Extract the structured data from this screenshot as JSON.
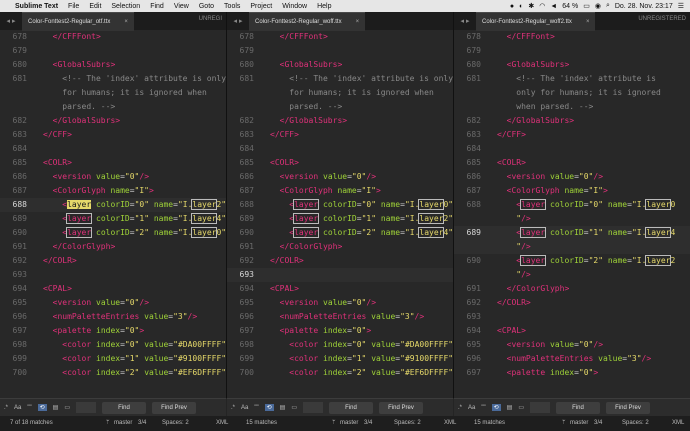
{
  "menubar": {
    "apple": "",
    "app_name": "Sublime Text",
    "items": [
      "File",
      "Edit",
      "Selection",
      "Find",
      "View",
      "Goto",
      "Tools",
      "Project",
      "Window",
      "Help"
    ],
    "battery": "64 %",
    "datetime": "Do. 28. Nov.  23:17"
  },
  "panes": [
    {
      "tab_title": "Color-Fonttest2-Regular_otf.ttx",
      "unregistered": "UNREGI"
    },
    {
      "tab_title": "Color-Fonttest2-Regular_woff.ttx",
      "unregistered": "UNREGISTERED"
    },
    {
      "tab_title": "Color-Fonttest2-Regular_woff2.ttx",
      "unregistered": "UNREGISTERED"
    }
  ],
  "code": {
    "p1": {
      "ln": [
        "678",
        "679",
        "680",
        "681",
        "",
        "",
        "682",
        "683",
        "684",
        "685",
        "686",
        "687",
        "688",
        "689",
        "690",
        "691",
        "692",
        "693",
        "694",
        "695",
        "696",
        "697",
        "698",
        "699",
        "700"
      ]
    },
    "p2": {
      "ln": [
        "678",
        "679",
        "680",
        "681",
        "",
        "",
        "682",
        "683",
        "684",
        "685",
        "686",
        "687",
        "688",
        "689",
        "690",
        "691",
        "692",
        "693",
        "694",
        "695",
        "696",
        "697",
        "698",
        "699",
        "700"
      ]
    },
    "p3": {
      "ln": [
        "678",
        "679",
        "680",
        "681",
        "",
        "",
        "682",
        "683",
        "684",
        "685",
        "686",
        "687",
        "688",
        "",
        "689",
        "",
        "690",
        "",
        "691",
        "692",
        "693",
        "694",
        "695",
        "696",
        "697"
      ]
    }
  },
  "findbar": {
    "regex": ".*",
    "case": "Aa",
    "word": "\"\"",
    "find_label": "Find",
    "find_prev_label": "Find Prev"
  },
  "status": {
    "p1": {
      "matches": "7 of 18 matches",
      "branch": "master",
      "branch_count": "3/4",
      "spaces": "Spaces: 2",
      "syntax": "XML"
    },
    "p2": {
      "matches": "15 matches",
      "branch": "master",
      "branch_count": "3/4",
      "spaces": "Spaces: 2",
      "syntax": "XML"
    },
    "p3": {
      "matches": "15 matches",
      "branch": "master",
      "branch_count": "3/4",
      "spaces": "Spaces: 2",
      "syntax": "XML"
    }
  }
}
